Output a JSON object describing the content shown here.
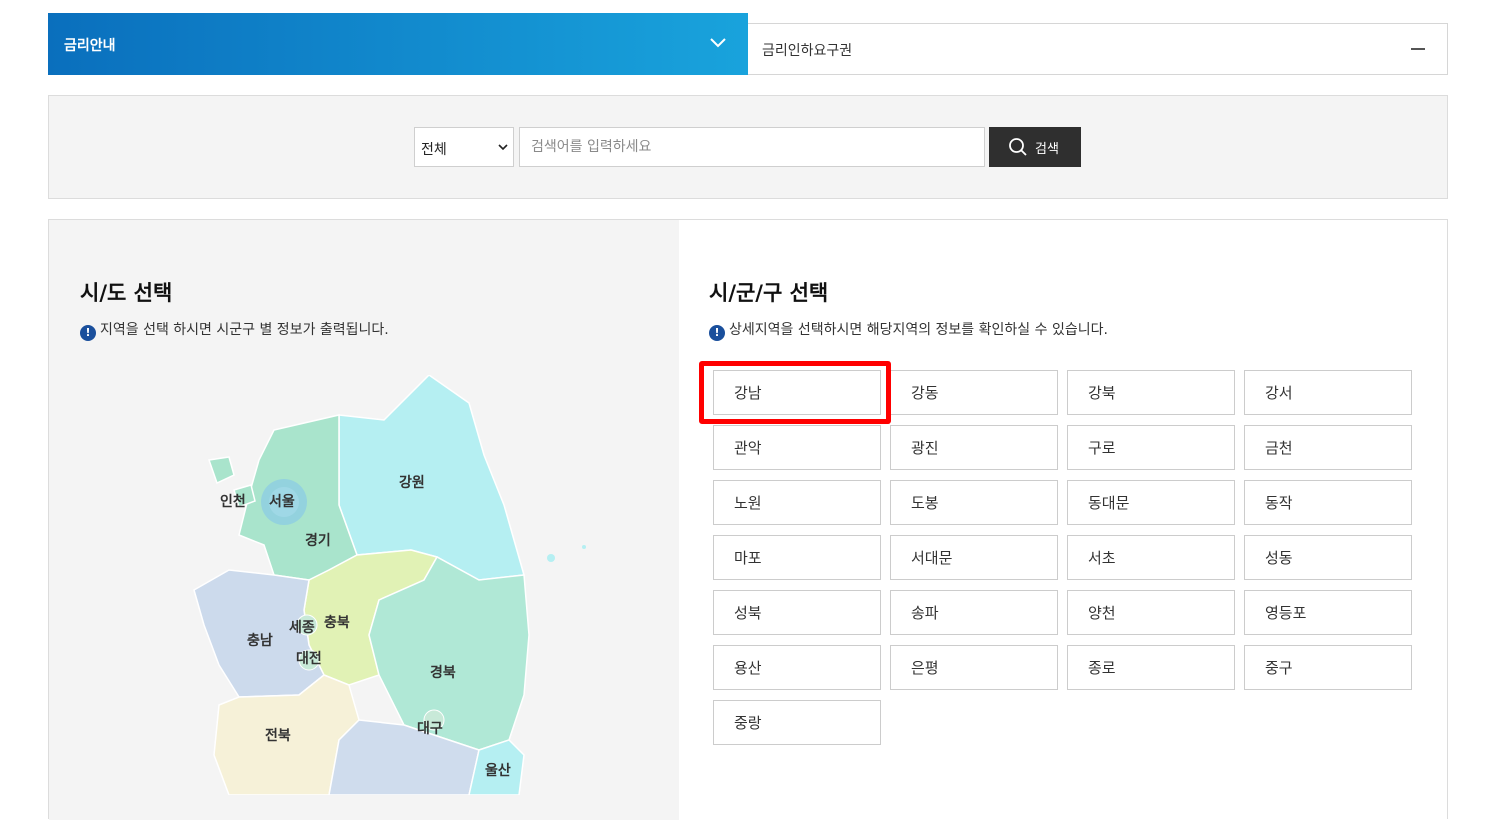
{
  "tabs": {
    "active_label": "금리안내",
    "other_label": "금리인하요구권"
  },
  "search": {
    "select_value": "전체",
    "placeholder": "검색어를 입력하세요",
    "button_label": "검색"
  },
  "sido": {
    "title": "시/도 선택",
    "note": "지역을 선택 하시면 시군구 별 정보가 출력됩니다.",
    "regions": [
      "인천",
      "서울",
      "강원",
      "경기",
      "충남",
      "세종",
      "충북",
      "대전",
      "경북",
      "전북",
      "대구",
      "울산"
    ]
  },
  "sigungu": {
    "title": "시/군/구 선택",
    "note": "상세지역을 선택하시면 해당지역의 정보를 확인하실 수 있습니다.",
    "districts": [
      "강남",
      "강동",
      "강북",
      "강서",
      "관악",
      "광진",
      "구로",
      "금천",
      "노원",
      "도봉",
      "동대문",
      "동작",
      "마포",
      "서대문",
      "서초",
      "성동",
      "성북",
      "송파",
      "양천",
      "영등포",
      "용산",
      "은평",
      "종로",
      "중구",
      "중랑"
    ]
  },
  "colors": {
    "tab_gradient_start": "#0a6fbd",
    "tab_gradient_end": "#19a3dc",
    "highlight": "#ff0000"
  }
}
